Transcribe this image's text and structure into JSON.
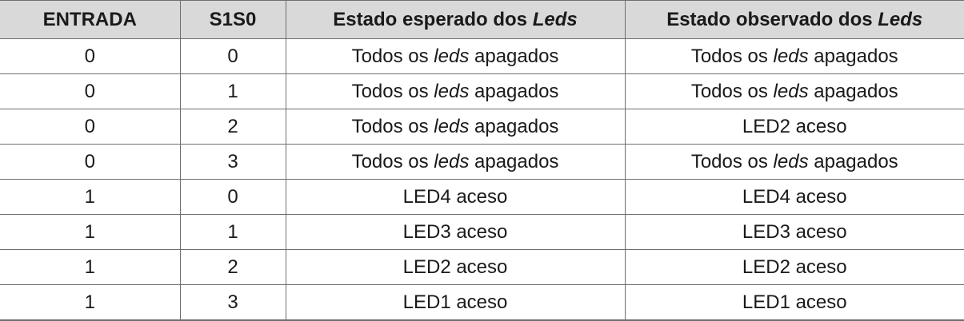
{
  "table": {
    "headers": {
      "entrada": "ENTRADA",
      "s1s0": "S1S0",
      "esperado_prefix": "Estado esperado dos",
      "esperado_italic": "Leds",
      "observado_prefix": "Estado observado dos",
      "observado_italic": "Leds"
    },
    "rows": [
      {
        "entrada": "0",
        "s1s0": "0",
        "esperado": {
          "before": "Todos os",
          "italic": "leds",
          "after": "apagados"
        },
        "observado": {
          "before": "Todos os",
          "italic": "leds",
          "after": "apagados"
        }
      },
      {
        "entrada": "0",
        "s1s0": "1",
        "esperado": {
          "before": "Todos os",
          "italic": "leds",
          "after": "apagados"
        },
        "observado": {
          "before": "Todos os",
          "italic": "leds",
          "after": "apagados"
        }
      },
      {
        "entrada": "0",
        "s1s0": "2",
        "esperado": {
          "before": "Todos os",
          "italic": "leds",
          "after": "apagados"
        },
        "observado": {
          "before": "LED2 aceso",
          "italic": "",
          "after": ""
        }
      },
      {
        "entrada": "0",
        "s1s0": "3",
        "esperado": {
          "before": "Todos os",
          "italic": "leds",
          "after": "apagados"
        },
        "observado": {
          "before": "Todos os",
          "italic": "leds",
          "after": "apagados"
        }
      },
      {
        "entrada": "1",
        "s1s0": "0",
        "esperado": {
          "before": "LED4 aceso",
          "italic": "",
          "after": ""
        },
        "observado": {
          "before": "LED4 aceso",
          "italic": "",
          "after": ""
        }
      },
      {
        "entrada": "1",
        "s1s0": "1",
        "esperado": {
          "before": "LED3 aceso",
          "italic": "",
          "after": ""
        },
        "observado": {
          "before": "LED3 aceso",
          "italic": "",
          "after": ""
        }
      },
      {
        "entrada": "1",
        "s1s0": "2",
        "esperado": {
          "before": "LED2 aceso",
          "italic": "",
          "after": ""
        },
        "observado": {
          "before": "LED2 aceso",
          "italic": "",
          "after": ""
        }
      },
      {
        "entrada": "1",
        "s1s0": "3",
        "esperado": {
          "before": "LED1 aceso",
          "italic": "",
          "after": ""
        },
        "observado": {
          "before": "LED1 aceso",
          "italic": "",
          "after": ""
        }
      }
    ]
  }
}
